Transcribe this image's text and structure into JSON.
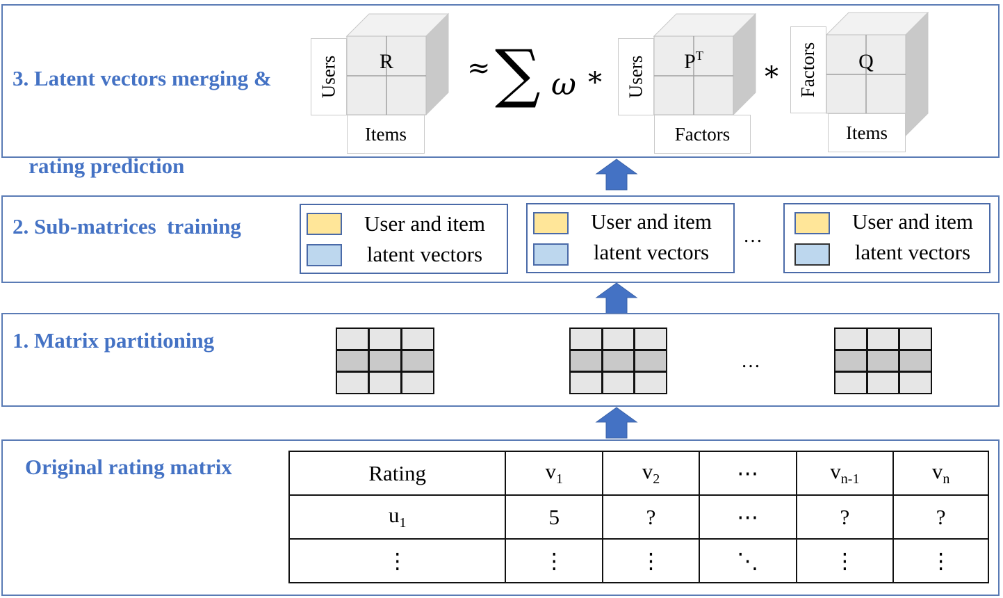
{
  "stages": {
    "stage3": {
      "title_line1": "3. Latent vectors merging &",
      "title_line2": "   rating prediction",
      "cubes": [
        {
          "name": "R",
          "superscript": "",
          "row_label": "Users",
          "col_label": "Items"
        },
        {
          "name": "P",
          "superscript": "T",
          "row_label": "Users",
          "col_label": "Factors"
        },
        {
          "name": "Q",
          "superscript": "",
          "row_label": "Factors",
          "col_label": "Items"
        }
      ],
      "formula": {
        "approx": "≈",
        "sum": "∑",
        "weight": "ω",
        "times": "*",
        "times2": "*"
      }
    },
    "stage2": {
      "title": "2. Sub-matrices  training",
      "legends": [
        {
          "line1": "User and item",
          "line2": "latent vectors"
        },
        {
          "line1": "User and item",
          "line2": "latent vectors"
        },
        {
          "line1": "User and item",
          "line2": "latent vectors"
        }
      ],
      "ellipsis": "…"
    },
    "stage1": {
      "title": "1. Matrix partitioning",
      "ellipsis": "…"
    },
    "stage0": {
      "title": "Original rating matrix",
      "table": {
        "header": {
          "corner": "Rating",
          "cols": [
            {
              "base": "v",
              "sub": "1"
            },
            {
              "base": "v",
              "sub": "2"
            },
            {
              "base": "⋯",
              "sub": ""
            },
            {
              "base": "v",
              "sub": "n-1"
            },
            {
              "base": "v",
              "sub": "n"
            }
          ]
        },
        "rows": [
          {
            "label": {
              "base": "u",
              "sub": "1"
            },
            "cells": [
              "5",
              "?",
              "⋯",
              "?",
              "?"
            ]
          },
          {
            "label": {
              "base": "⋮",
              "sub": ""
            },
            "cells": [
              "⋮",
              "⋮",
              "⋱",
              "⋮",
              "⋮"
            ]
          }
        ]
      }
    }
  },
  "colors": {
    "title_blue": "#4472c4",
    "panel_border": "#5a7bb5",
    "arrow_blue": "#4472c4",
    "swatch_yellow": "#ffe699",
    "swatch_blue": "#bdd7ee"
  }
}
